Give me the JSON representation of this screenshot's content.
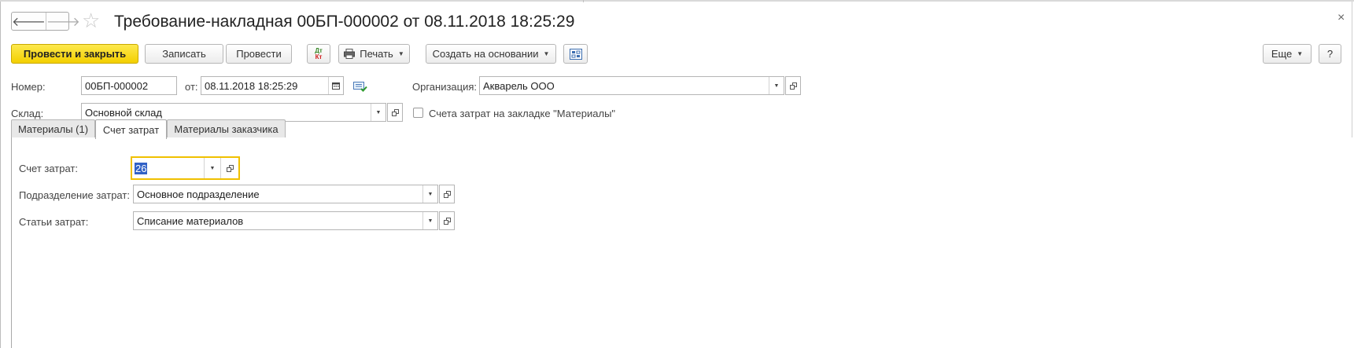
{
  "header": {
    "title": "Требование-накладная 00БП-000002 от 08.11.2018 18:25:29",
    "back_glyph": "🡐",
    "forward_glyph": "🡒",
    "star_glyph": "☆",
    "close_glyph": "×"
  },
  "toolbar": {
    "post_close_label": "Провести и закрыть",
    "save_label": "Записать",
    "post_label": "Провести",
    "dtkt_top": "Дт",
    "dtkt_bottom": "Кт",
    "print_label": "Печать",
    "create_based_label": "Создать на основании",
    "more_label": "Еще",
    "help_label": "?"
  },
  "form": {
    "number_label": "Номер:",
    "number_value": "00БП-000002",
    "date_label": "от:",
    "date_value": "08.11.2018 18:25:29",
    "org_label": "Организация:",
    "org_value": "Акварель ООО",
    "warehouse_label": "Склад:",
    "warehouse_value": "Основной склад",
    "checkbox_label": "Счета затрат на закладке \"Материалы\"",
    "checkbox_checked": false
  },
  "tabs": [
    {
      "label": "Материалы (1)",
      "active": false
    },
    {
      "label": "Счет затрат",
      "active": true
    },
    {
      "label": "Материалы заказчика",
      "active": false
    }
  ],
  "cost_panel": {
    "account_label": "Счет затрат:",
    "account_value": "26",
    "department_label": "Подразделение затрат:",
    "department_value": "Основное подразделение",
    "cost_item_label": "Статьи затрат:",
    "cost_item_value": "Списание материалов"
  },
  "colors": {
    "primary_button": "#f5d400",
    "focus_border": "#f0c000",
    "selection": "#3161c6"
  }
}
